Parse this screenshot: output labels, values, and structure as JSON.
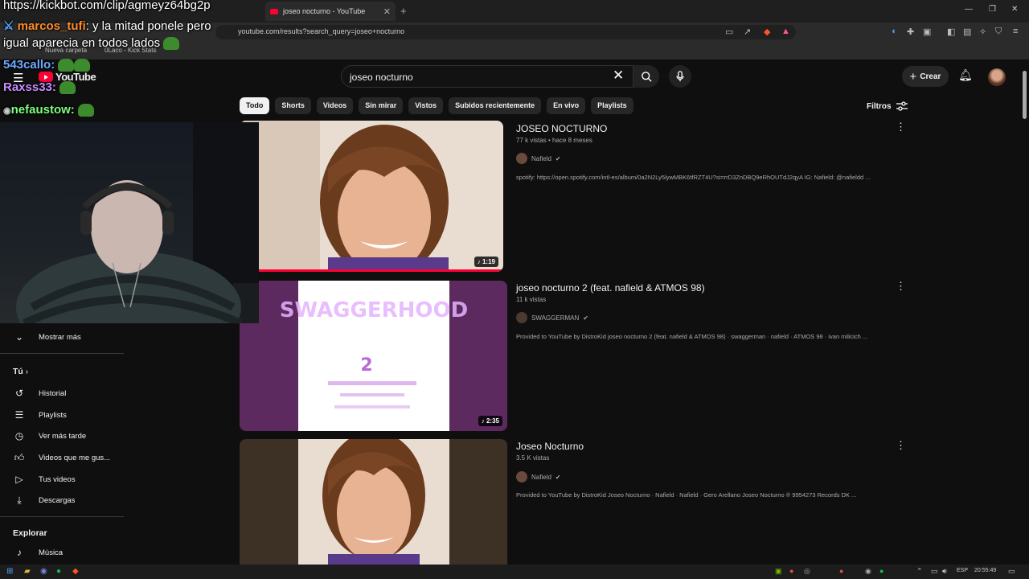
{
  "browser": {
    "tab_title": "joseo nocturno - YouTube",
    "url": "youtube.com/results?search_query=joseo+nocturno",
    "bookmarks": [
      "Nueva carpeta",
      "0Laco - Kick Stats"
    ]
  },
  "header": {
    "logo": "YouTube",
    "search_value": "joseo nocturno",
    "create_label": "Crear"
  },
  "chips": [
    "Todo",
    "Shorts",
    "Videos",
    "Sin mirar",
    "Vistos",
    "Subidos recientemente",
    "En vivo",
    "Playlists"
  ],
  "filters_label": "Filtros",
  "results": [
    {
      "title": "JOSEO NOCTURNO",
      "meta": "77 k vistas • hace 8 meses",
      "channel": "Nafield",
      "description": "spotify: https://open.spotify.com/intl-es/album/0a2N2Ly5lywMBK6tfRZT4U?si=rrD3ZnDBQ9eRhOUTdJ2qyA IG: Nafield: @nafieldd ...",
      "duration": "1:19",
      "progress": 1.0
    },
    {
      "title": "joseo nocturno 2 (feat. nafield & ATMOS 98)",
      "meta": "11 k vistas",
      "channel": "SWAGGERMAN",
      "description": "Provided to YouTube by DistroKid joseo nocturno 2 (feat. nafield & ATMOS 98) · swaggerman · nafield · ATMOS 98 · ivan milicich ...",
      "duration": "2:35"
    },
    {
      "title": "Joseo Nocturno",
      "meta": "3.5 K vistas",
      "channel": "Nafield",
      "description": "Provided to YouTube by DistroKid Joseo Nocturno · Nafield · Nafield · Gero Arellano Joseo Nocturno ℗ 9954273 Records DK ..."
    }
  ],
  "sidebar": {
    "show_more": "Mostrar más",
    "you_heading": "Tú",
    "items": [
      "Historial",
      "Playlists",
      "Ver más tarde",
      "Videos que me gus...",
      "Tus videos",
      "Descargas"
    ],
    "explore_heading": "Explorar",
    "explore_items": [
      "Música"
    ]
  },
  "chat": {
    "link": "https://kickbot.com/clip/agmeyz64bg2p",
    "line1_user": "marcos_tufi",
    "line1_msg": ": y la mitad ponele pero",
    "line2_msg": "igual aparecia en todos lados",
    "user2": "543callo:",
    "user3": "Raxss33:",
    "user4": "nefaustow:"
  },
  "taskbar": {
    "lang": "ESP",
    "time": "20:55:49"
  },
  "colors": {
    "accent": "#ff0033",
    "background": "#0f0f0f"
  }
}
